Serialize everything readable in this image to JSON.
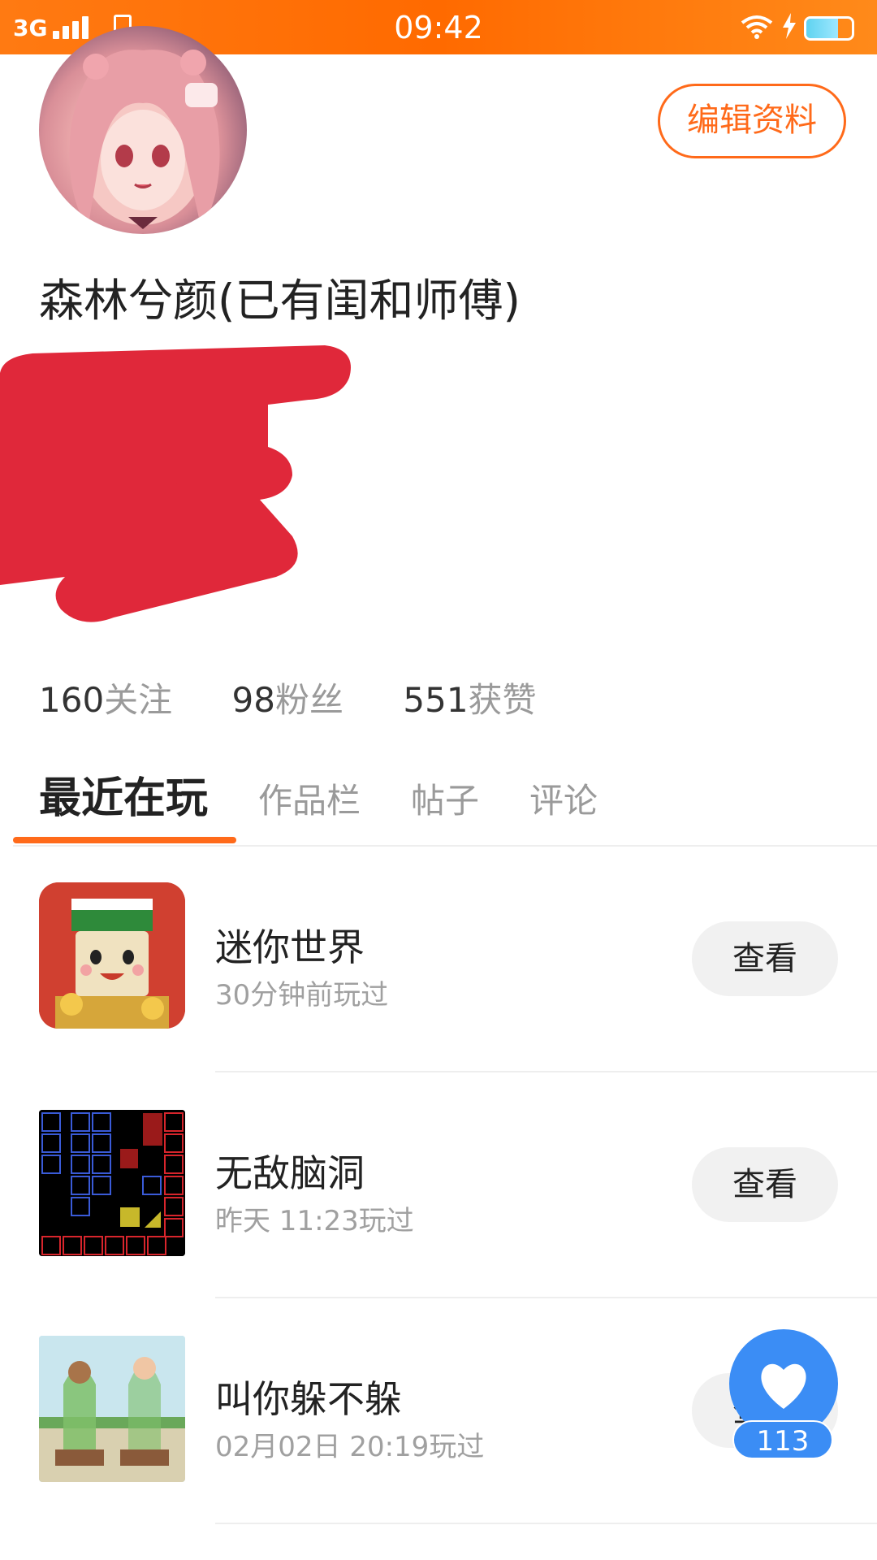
{
  "status_bar": {
    "network": "3G",
    "time": "09:42",
    "battery_level": 0.7
  },
  "profile": {
    "edit_button": "编辑资料",
    "nickname": "森林兮颜(已有闺和师傅)"
  },
  "stats": [
    {
      "num": "160",
      "label": "关注"
    },
    {
      "num": "98",
      "label": "粉丝"
    },
    {
      "num": "551",
      "label": "获赞"
    }
  ],
  "tabs": [
    {
      "label": "最近在玩",
      "active": true
    },
    {
      "label": "作品栏",
      "active": false
    },
    {
      "label": "帖子",
      "active": false
    },
    {
      "label": "评论",
      "active": false
    }
  ],
  "games": [
    {
      "title": "迷你世界",
      "subtitle": "30分钟前玩过",
      "button": "查看",
      "icon": "mini-world-icon"
    },
    {
      "title": "无敌脑洞",
      "subtitle": "昨天 11:23玩过",
      "button": "查看",
      "icon": "brain-hole-icon"
    },
    {
      "title": "叫你躲不躲",
      "subtitle": "02月02日 20:19玩过",
      "button": "查看",
      "icon": "hide-game-icon"
    }
  ],
  "like_fab": {
    "count": "113",
    "icon": "heart-icon"
  },
  "colors": {
    "accent": "#ff6a1a",
    "status_bar": "#ff7a12",
    "fab": "#3b8df5"
  }
}
